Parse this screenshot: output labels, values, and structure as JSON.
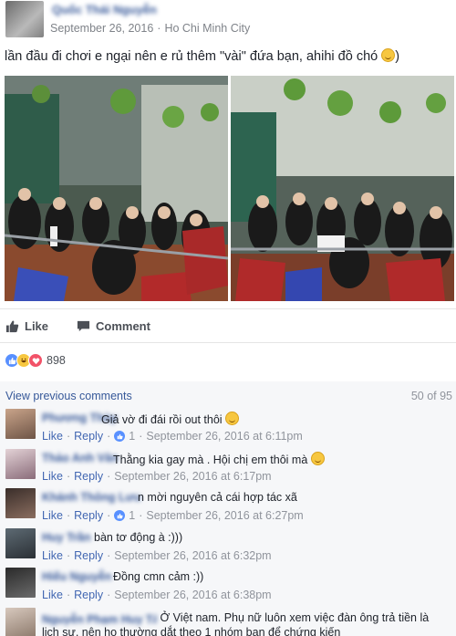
{
  "post": {
    "author_name": "Quốc Thái Nguyễn",
    "date": "September 26, 2016",
    "location": "Ho Chi Minh City",
    "text": "lần đầu đi chơi e ngại nên e rủ thêm \"vài\" đứa bạn, ahihi đồ chó",
    "text_end": ")"
  },
  "actions": {
    "like_label": "Like",
    "comment_label": "Comment"
  },
  "reactions": {
    "count": "898"
  },
  "comments_header": {
    "view_previous": "View previous comments",
    "counter": "50 of 95"
  },
  "comment_actions": {
    "like": "Like",
    "reply": "Reply"
  },
  "comments": [
    {
      "name": "Phương Thùy",
      "text": "Giả vờ đi đái rồi out thôi",
      "likes": "1",
      "time": "September 26, 2016 at 6:11pm"
    },
    {
      "name": "Thảo Anh Vân",
      "text": "Thằng kia gay mà . Hội chị em thôi mà",
      "likes": "",
      "time": "September 26, 2016 at 6:17pm"
    },
    {
      "name": "Khánh Thông Lưu",
      "text": "n mời nguyên cả cái hợp tác xã",
      "likes": "1",
      "time": "September 26, 2016 at 6:27pm"
    },
    {
      "name": "Huy Trần",
      "text": "bàn tơ động à :)))",
      "likes": "",
      "time": "September 26, 2016 at 6:32pm"
    },
    {
      "name": "Hiếu Nguyễn",
      "text": "Đồng cmn cảm :))",
      "likes": "",
      "time": "September 26, 2016 at 6:38pm"
    },
    {
      "name": "Nguyễn Phạm Huy Tài",
      "text": "Ở Việt nam. Phụ nữ luôn xem việc đàn ông trả tiền là lịch sư, nên họ thường dắt theo 1 nhóm bạn để chứng kiến",
      "likes": "",
      "time": ""
    }
  ],
  "colors": {
    "link": "#365899",
    "meta": "#90949c",
    "like_blue": "#5890ff",
    "love_red": "#f25268",
    "haha_yellow": "#f7c740"
  }
}
